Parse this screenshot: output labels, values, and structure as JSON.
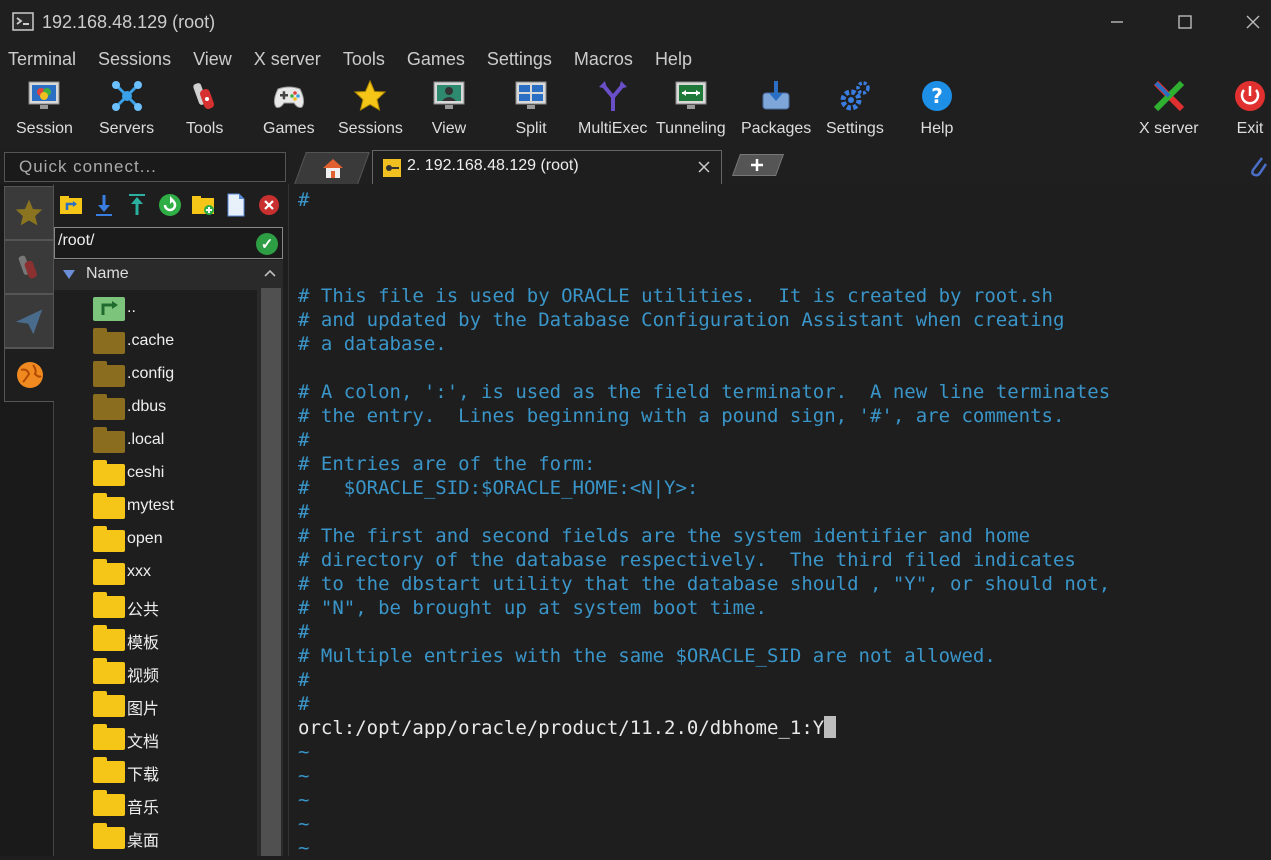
{
  "window": {
    "title": "192.168.48.129 (root)"
  },
  "menu": [
    "Terminal",
    "Sessions",
    "View",
    "X server",
    "Tools",
    "Games",
    "Settings",
    "Macros",
    "Help"
  ],
  "toolbar": {
    "session": "Session",
    "servers": "Servers",
    "tools": "Tools",
    "games": "Games",
    "sessions": "Sessions",
    "view": "View",
    "split": "Split",
    "multiexec": "MultiExec",
    "tunneling": "Tunneling",
    "packages": "Packages",
    "settings": "Settings",
    "help": "Help",
    "xserver": "X server",
    "exit": "Exit"
  },
  "quick_connect": {
    "placeholder": "Quick connect..."
  },
  "tabs": {
    "active_label": "2. 192.168.48.129 (root)"
  },
  "browser": {
    "path": "/root/",
    "column_header": "Name",
    "files": [
      {
        "name": "..",
        "kind": "parent"
      },
      {
        "name": ".cache",
        "kind": "hidden"
      },
      {
        "name": ".config",
        "kind": "hidden"
      },
      {
        "name": ".dbus",
        "kind": "hidden"
      },
      {
        "name": ".local",
        "kind": "hidden"
      },
      {
        "name": "ceshi",
        "kind": "folder"
      },
      {
        "name": "mytest",
        "kind": "folder"
      },
      {
        "name": "open",
        "kind": "folder"
      },
      {
        "name": "xxx",
        "kind": "folder"
      },
      {
        "name": "公共",
        "kind": "folder"
      },
      {
        "name": "模板",
        "kind": "folder"
      },
      {
        "name": "视频",
        "kind": "folder"
      },
      {
        "name": "图片",
        "kind": "folder"
      },
      {
        "name": "文档",
        "kind": "folder"
      },
      {
        "name": "下载",
        "kind": "folder"
      },
      {
        "name": "音乐",
        "kind": "folder"
      },
      {
        "name": "桌面",
        "kind": "folder"
      }
    ]
  },
  "terminal": {
    "lines": [
      {
        "text": "#",
        "kind": "comment"
      },
      {
        "text": "",
        "kind": "blank"
      },
      {
        "text": "",
        "kind": "blank"
      },
      {
        "text": "",
        "kind": "blank"
      },
      {
        "text": "# This file is used by ORACLE utilities.  It is created by root.sh",
        "kind": "comment"
      },
      {
        "text": "# and updated by the Database Configuration Assistant when creating",
        "kind": "comment"
      },
      {
        "text": "# a database.",
        "kind": "comment"
      },
      {
        "text": "",
        "kind": "blank"
      },
      {
        "text": "# A colon, ':', is used as the field terminator.  A new line terminates",
        "kind": "comment"
      },
      {
        "text": "# the entry.  Lines beginning with a pound sign, '#', are comments.",
        "kind": "comment"
      },
      {
        "text": "#",
        "kind": "comment"
      },
      {
        "text": "# Entries are of the form:",
        "kind": "comment"
      },
      {
        "text": "#   $ORACLE_SID:$ORACLE_HOME:<N|Y>:",
        "kind": "comment"
      },
      {
        "text": "#",
        "kind": "comment"
      },
      {
        "text": "# The first and second fields are the system identifier and home",
        "kind": "comment"
      },
      {
        "text": "# directory of the database respectively.  The third filed indicates",
        "kind": "comment"
      },
      {
        "text": "# to the dbstart utility that the database should , \"Y\", or should not,",
        "kind": "comment"
      },
      {
        "text": "# \"N\", be brought up at system boot time.",
        "kind": "comment"
      },
      {
        "text": "#",
        "kind": "comment"
      },
      {
        "text": "# Multiple entries with the same $ORACLE_SID are not allowed.",
        "kind": "comment"
      },
      {
        "text": "#",
        "kind": "comment"
      },
      {
        "text": "#",
        "kind": "comment"
      },
      {
        "text": "orcl:/opt/app/oracle/product/11.2.0/dbhome_1:Y",
        "kind": "plain",
        "cursor": true
      },
      {
        "text": "~",
        "kind": "tilde"
      },
      {
        "text": "~",
        "kind": "tilde"
      },
      {
        "text": "~",
        "kind": "tilde"
      },
      {
        "text": "~",
        "kind": "tilde"
      },
      {
        "text": "~",
        "kind": "tilde"
      }
    ]
  },
  "colors": {
    "comment": "#3a95c9",
    "folder_yellow": "#f5c518",
    "folder_hidden": "#8a6d1e",
    "background": "#1e1e1e"
  }
}
